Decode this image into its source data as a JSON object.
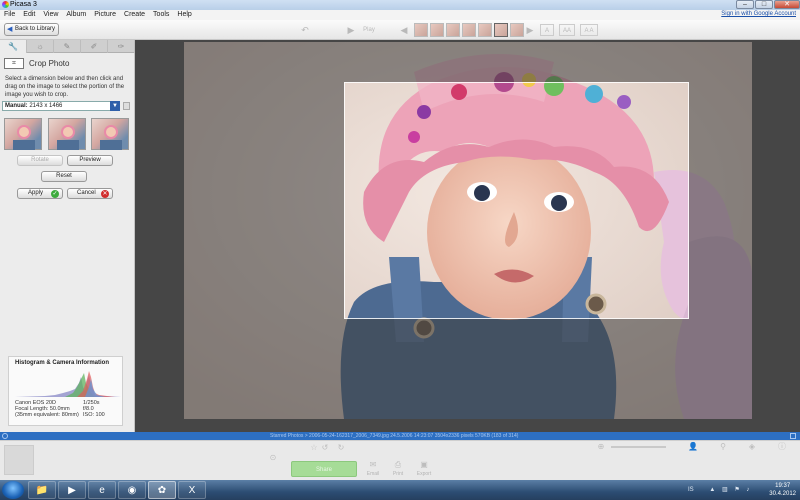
{
  "window": {
    "title": "Picasa 3"
  },
  "menu": [
    "File",
    "Edit",
    "View",
    "Album",
    "Picture",
    "Create",
    "Tools",
    "Help"
  ],
  "signin_link": "Sign in with Google Account",
  "toolbar": {
    "back_label": "Back to Library",
    "play_label": "Play"
  },
  "edit_tabs": [
    {
      "icon": "wrench-icon",
      "glyph": "🔧"
    },
    {
      "icon": "light-icon",
      "glyph": "☼"
    },
    {
      "icon": "brush-icon",
      "glyph": "✎"
    },
    {
      "icon": "effects-brush-icon",
      "glyph": "✐"
    },
    {
      "icon": "effects-brush-2-icon",
      "glyph": "✑"
    }
  ],
  "crop": {
    "title": "Crop Photo",
    "instructions": "Select a dimension below and then click and drag on the image to select the portion of the image you wish to crop.",
    "dimension_label": "Manual:",
    "dimension_value": "2143 x 1466",
    "rotate_label": "Rotate",
    "preview_label": "Preview",
    "reset_label": "Reset",
    "apply_label": "Apply",
    "cancel_label": "Cancel"
  },
  "histogram": {
    "title": "Histogram & Camera Information",
    "camera": "Canon EOS 20D",
    "focal_length": "Focal Length: 50.0mm",
    "equivalent": "(35mm equivalent: 80mm)",
    "shutter": "1/250s",
    "aperture": "f/8.0",
    "iso": "ISO: 100"
  },
  "status_text": "Starred Photos > 2006-05-24-162317_2006_7349.jpg     24.5.2006 14:23:07     3504x2336 pixels     570KB     (183 of 314)",
  "tray": {
    "share_label": "Share",
    "email_label": "Email",
    "print_label": "Print",
    "export_label": "Export"
  },
  "clock": {
    "time": "19:37",
    "date": "30.4.2012"
  },
  "language": "IS",
  "colors": {
    "accent": "#2d6fc2",
    "apply_icon": "#3cab3c",
    "cancel_icon": "#d12d2d",
    "share": "#a6dc97"
  }
}
